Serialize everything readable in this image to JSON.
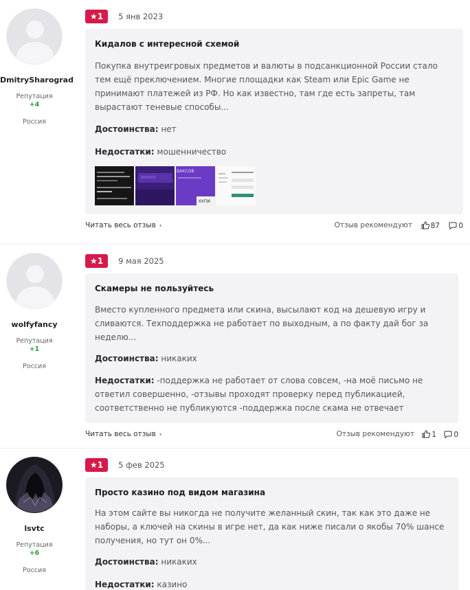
{
  "reviews": [
    {
      "user": {
        "name": "DmitrySharograd",
        "reputation_label": "Репутация",
        "reputation": "+4",
        "country": "Россия"
      },
      "rating": "1",
      "date": "5 янв 2023",
      "title": "Кидалов с интересной схемой",
      "text": "Покупка внутреигровых предметов и валюты в подсанкционной России стало тем ещё преключением. Многие площадки как Steam или Epic Game не принимают платежей из РФ. Но как известно, там где есть запреты, там вырастают теневые способы...",
      "pros_label": "Достоинства:",
      "pros": "нет",
      "cons_label": "Недостатки:",
      "cons": "мошенничество",
      "thumb_texts": [
        "ВАКСОВ",
        "КУПИ"
      ],
      "read_more": "Читать весь отзыв",
      "recommend_label": "Отзыв рекомендуют",
      "likes": "87",
      "comments": "0"
    },
    {
      "user": {
        "name": "wolfyfancy",
        "reputation_label": "Репутация",
        "reputation": "+1",
        "country": "Россия"
      },
      "rating": "1",
      "date": "9 мая 2025",
      "title": "Скамеры не пользуйтесь",
      "text": "Вместо купленного предмета или скина, высылают код на дешевую игру и сливаются. Техподдержка не работает по выходным, а по факту дай бог за неделю...",
      "pros_label": "Достоинства:",
      "pros": "никаких",
      "cons_label": "Недостатки:",
      "cons": "-поддержка не работает от слова совсем, -на моё письмо не ответил совершенно, -отзывы проходят проверку перед публикацией, соответственно не публикуются -поддержка после скама не отвечает",
      "read_more": "Читать весь отзыв",
      "recommend_label": "Отзыв рекомендуют",
      "likes": "1",
      "comments": "0"
    },
    {
      "user": {
        "name": "lsvtc",
        "reputation_label": "Репутация",
        "reputation": "+6",
        "country": "Россия"
      },
      "rating": "1",
      "date": "5 фев 2025",
      "title": "Просто казино под видом магазина",
      "text": "На этом сайте вы никогда не получите желанный скин, так как это даже не наборы, а ключей на скины в игре нет, да как ниже писали о якобы 70% шансе получения, но тут он 0%...",
      "pros_label": "Достоинства:",
      "pros": "никаких",
      "cons_label": "Недостатки:",
      "cons": "казино"
    }
  ],
  "colors": {
    "rating_badge": "#d61a4a",
    "reputation": "#2e9d2e",
    "card_bg": "#f3f3f5"
  }
}
